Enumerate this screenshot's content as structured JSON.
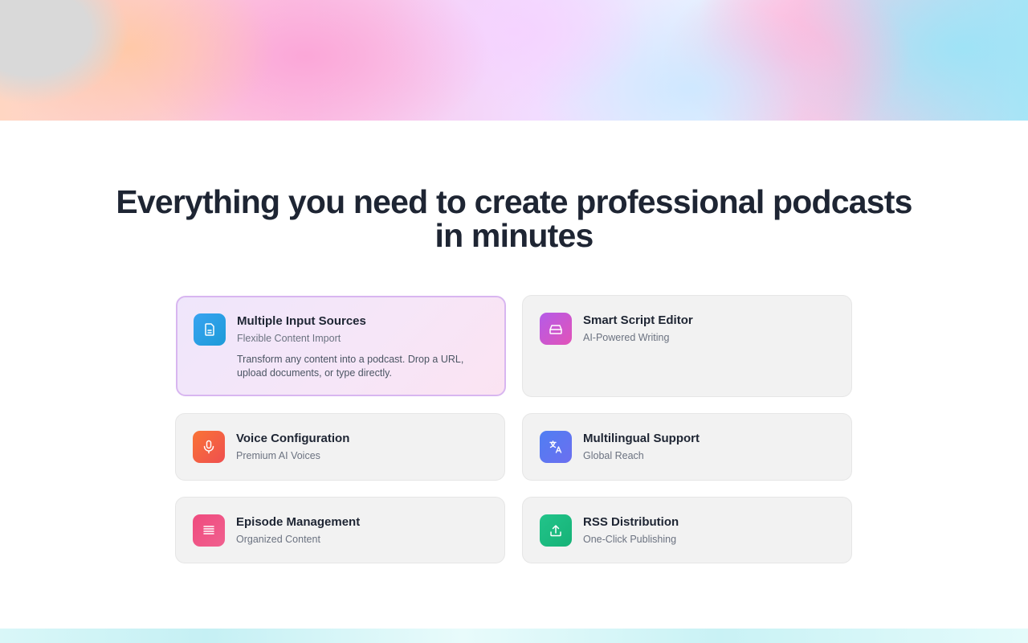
{
  "heading": "Everything you need to create professional podcasts in minutes",
  "features": [
    {
      "title": "Multiple Input Sources",
      "subtitle": "Flexible Content Import",
      "description": "Transform any content into a podcast. Drop a URL, upload documents, or type directly.",
      "icon": "document-icon",
      "gradient": [
        "#38a3f1",
        "#1d9bd8"
      ],
      "active": true
    },
    {
      "title": "Smart Script Editor",
      "subtitle": "AI-Powered Writing",
      "icon": "inbox-tray-icon",
      "gradient": [
        "#b45be8",
        "#e253b8"
      ]
    },
    {
      "title": "Voice Configuration",
      "subtitle": "Premium AI Voices",
      "icon": "microphone-icon",
      "gradient": [
        "#f97336",
        "#ef4f4f"
      ]
    },
    {
      "title": "Multilingual Support",
      "subtitle": "Global Reach",
      "icon": "translate-icon",
      "gradient": [
        "#4f7ef2",
        "#6c6ff0"
      ]
    },
    {
      "title": "Episode Management",
      "subtitle": "Organized Content",
      "icon": "list-icon",
      "gradient": [
        "#ef4b7e",
        "#f0608f"
      ]
    },
    {
      "title": "RSS Distribution",
      "subtitle": "One-Click Publishing",
      "icon": "upload-icon",
      "gradient": [
        "#22c48a",
        "#16b277"
      ]
    }
  ]
}
